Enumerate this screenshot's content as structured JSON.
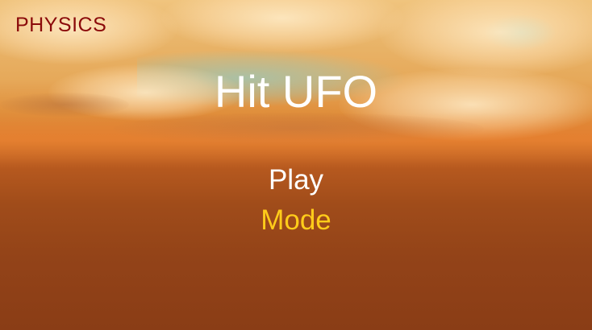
{
  "game": {
    "brand_label": "PHYSICS",
    "title": "Hit UFO"
  },
  "menu": {
    "items": [
      {
        "label": "Play",
        "color": "#ffffff",
        "selected": false
      },
      {
        "label": "Mode",
        "color": "#ffcc1a",
        "selected": true
      }
    ]
  },
  "colors": {
    "brand": "#8b0a0a",
    "title": "#ffffff",
    "highlight": "#ffcc1a"
  }
}
